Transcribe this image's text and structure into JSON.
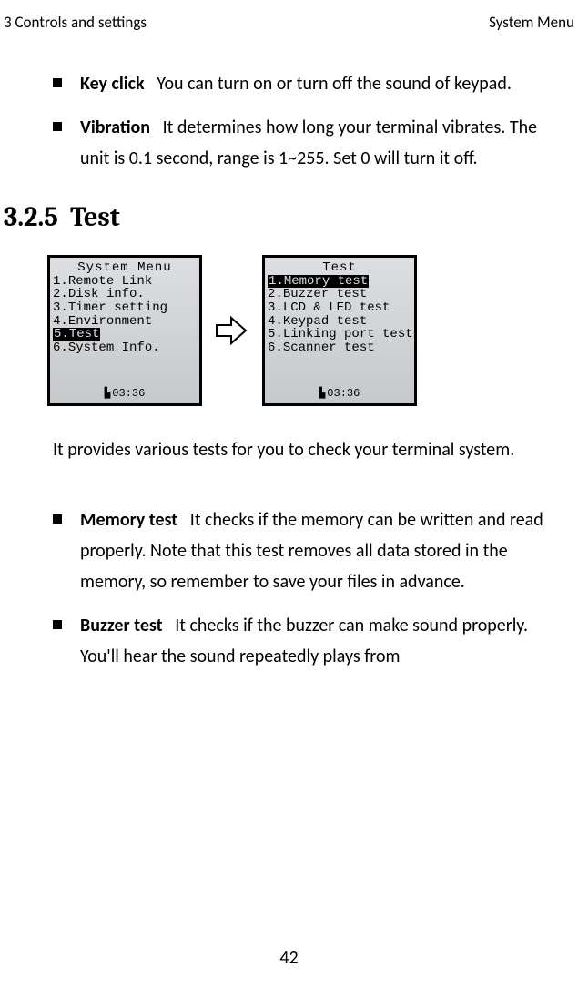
{
  "header": {
    "left": "3 Controls and settings",
    "right": "System Menu"
  },
  "bullets_top": [
    {
      "term": "Key click",
      "desc": "You can turn on or turn off the sound of keypad."
    },
    {
      "term": "Vibration",
      "desc": "It determines how long your terminal vibrates. The unit is 0.1 second, range is 1~255. Set 0 will turn it off."
    }
  ],
  "section": {
    "number": "3.2.5",
    "title": "Test"
  },
  "screen_left": {
    "title": "System Menu",
    "items": [
      {
        "n": "1",
        "label": "Remote Link",
        "hl": false
      },
      {
        "n": "2",
        "label": "Disk info.",
        "hl": false
      },
      {
        "n": "3",
        "label": "Timer setting",
        "hl": false
      },
      {
        "n": "4",
        "label": "Environment",
        "hl": false
      },
      {
        "n": "5",
        "label": "Test",
        "hl": true
      },
      {
        "n": "6",
        "label": "System Info.",
        "hl": false
      }
    ],
    "time": "03:36"
  },
  "screen_right": {
    "title": "Test",
    "items": [
      {
        "n": "1",
        "label": "Memory test",
        "hl": true
      },
      {
        "n": "2",
        "label": "Buzzer test",
        "hl": false
      },
      {
        "n": "3",
        "label": "LCD & LED test",
        "hl": false
      },
      {
        "n": "4",
        "label": "Keypad test",
        "hl": false
      },
      {
        "n": "5",
        "label": "Linking port test",
        "hl": false
      },
      {
        "n": "6",
        "label": "Scanner test",
        "hl": false
      }
    ],
    "time": "03:36"
  },
  "para": "It provides various tests for you to check your terminal system.",
  "bullets_bottom": [
    {
      "term": "Memory test",
      "desc": "It checks if the memory can be written and read properly. Note that this test removes all data stored in the memory, so remember to save your files in advance."
    },
    {
      "term": "Buzzer test",
      "desc": "It checks if the buzzer can make sound properly. You'll hear the sound repeatedly plays from"
    }
  ],
  "page": "42"
}
